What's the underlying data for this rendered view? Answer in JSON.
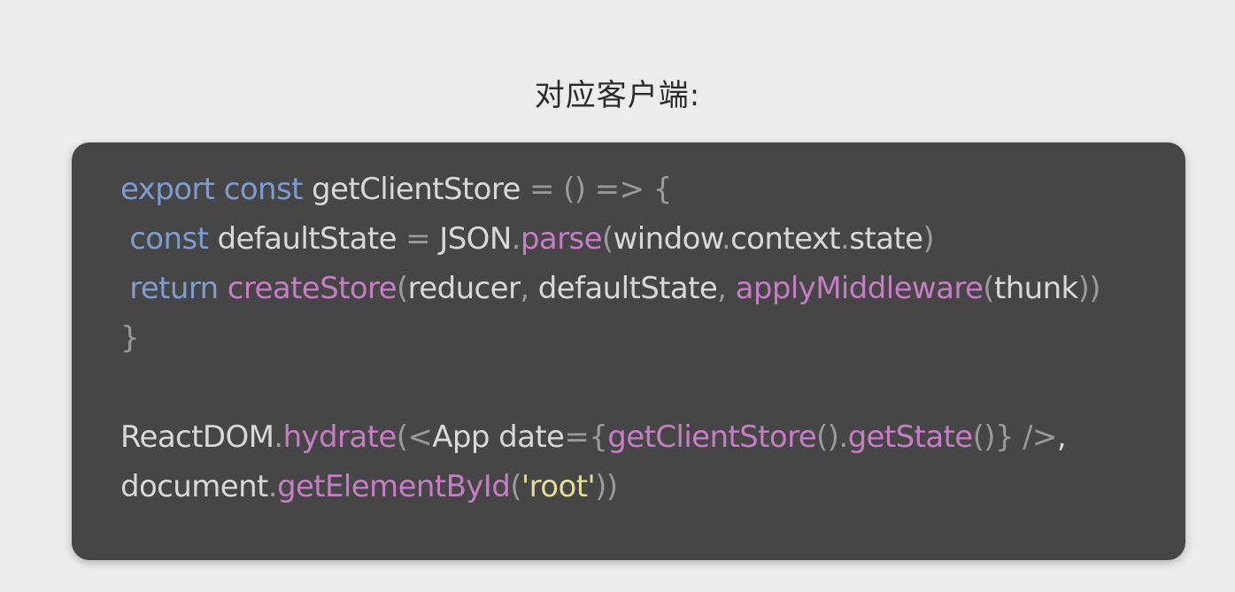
{
  "heading": "对应客户端:",
  "colors": {
    "background": "#ececec",
    "code_background": "#464646",
    "keyword": "#7f9ccf",
    "function": "#c77dc5",
    "string": "#e3dc9a",
    "punctuation": "#9a9a9a",
    "identifier": "#d8d8d8"
  },
  "code": {
    "lines": [
      {
        "indent": "",
        "tokens": [
          {
            "t": "kw",
            "v": "export const "
          },
          {
            "t": "id",
            "v": "getClientStore "
          },
          {
            "t": "punc",
            "v": "= () => {"
          }
        ]
      },
      {
        "indent": " ",
        "tokens": [
          {
            "t": "kw",
            "v": "const "
          },
          {
            "t": "id",
            "v": "defaultState "
          },
          {
            "t": "punc",
            "v": "= "
          },
          {
            "t": "id",
            "v": "JSON"
          },
          {
            "t": "punc",
            "v": "."
          },
          {
            "t": "fn",
            "v": "parse"
          },
          {
            "t": "punc",
            "v": "("
          },
          {
            "t": "id",
            "v": "window"
          },
          {
            "t": "punc",
            "v": "."
          },
          {
            "t": "id",
            "v": "context"
          },
          {
            "t": "punc",
            "v": "."
          },
          {
            "t": "id",
            "v": "state"
          },
          {
            "t": "punc",
            "v": ")"
          }
        ]
      },
      {
        "indent": " ",
        "tokens": [
          {
            "t": "kw",
            "v": "return "
          },
          {
            "t": "fn",
            "v": "createStore"
          },
          {
            "t": "punc",
            "v": "("
          },
          {
            "t": "id",
            "v": "reducer"
          },
          {
            "t": "punc",
            "v": ", "
          },
          {
            "t": "id",
            "v": "defaultState"
          },
          {
            "t": "punc",
            "v": ", "
          },
          {
            "t": "fn",
            "v": "applyMiddleware"
          },
          {
            "t": "punc",
            "v": "("
          },
          {
            "t": "id",
            "v": "thunk"
          },
          {
            "t": "punc",
            "v": "))"
          }
        ]
      },
      {
        "indent": "",
        "tokens": [
          {
            "t": "punc",
            "v": "}"
          }
        ]
      },
      {
        "indent": "",
        "tokens": []
      },
      {
        "indent": "",
        "tokens": [
          {
            "t": "id",
            "v": "ReactDOM"
          },
          {
            "t": "punc",
            "v": "."
          },
          {
            "t": "fn",
            "v": "hydrate"
          },
          {
            "t": "punc",
            "v": "(<"
          },
          {
            "t": "id",
            "v": "App date"
          },
          {
            "t": "punc",
            "v": "={"
          },
          {
            "t": "fn",
            "v": "getClientStore"
          },
          {
            "t": "punc",
            "v": "()."
          },
          {
            "t": "fn",
            "v": "getState"
          },
          {
            "t": "punc",
            "v": "()} />"
          },
          {
            "t": "id",
            "v": ","
          }
        ]
      },
      {
        "indent": "",
        "tokens": [
          {
            "t": "id",
            "v": "document"
          },
          {
            "t": "punc",
            "v": "."
          },
          {
            "t": "fn",
            "v": "getElementById"
          },
          {
            "t": "punc",
            "v": "("
          },
          {
            "t": "str",
            "v": "'root'"
          },
          {
            "t": "punc",
            "v": "))"
          }
        ]
      }
    ]
  }
}
